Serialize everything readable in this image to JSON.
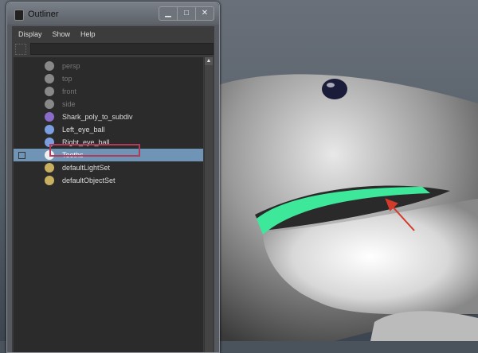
{
  "window": {
    "title": "Outliner",
    "controls": [
      "minimize",
      "maximize",
      "close"
    ]
  },
  "menu": [
    "Display",
    "Show",
    "Help"
  ],
  "filter": {
    "value": "",
    "placeholder": ""
  },
  "items": [
    {
      "label": "persp",
      "icon": "camera-icon",
      "dim": true
    },
    {
      "label": "top",
      "icon": "camera-icon",
      "dim": true
    },
    {
      "label": "front",
      "icon": "camera-icon",
      "dim": true
    },
    {
      "label": "side",
      "icon": "camera-icon",
      "dim": true
    },
    {
      "label": "Shark_poly_to_subdiv",
      "icon": "subdiv-icon",
      "dim": false
    },
    {
      "label": "Left_eye_ball",
      "icon": "nurbs-surface-icon",
      "dim": false
    },
    {
      "label": "Right_eye_ball",
      "icon": "nurbs-surface-icon",
      "dim": false
    },
    {
      "label": "Teeths",
      "icon": "mesh-icon",
      "dim": false,
      "selected": true
    },
    {
      "label": "defaultLightSet",
      "icon": "set-icon",
      "dim": false
    },
    {
      "label": "defaultObjectSet",
      "icon": "set-icon",
      "dim": false
    }
  ],
  "colors": {
    "selection": "#6f94b5",
    "highlight": "#b13a5a",
    "arrow": "#d23a2a",
    "teeth": "#3ee89a"
  }
}
